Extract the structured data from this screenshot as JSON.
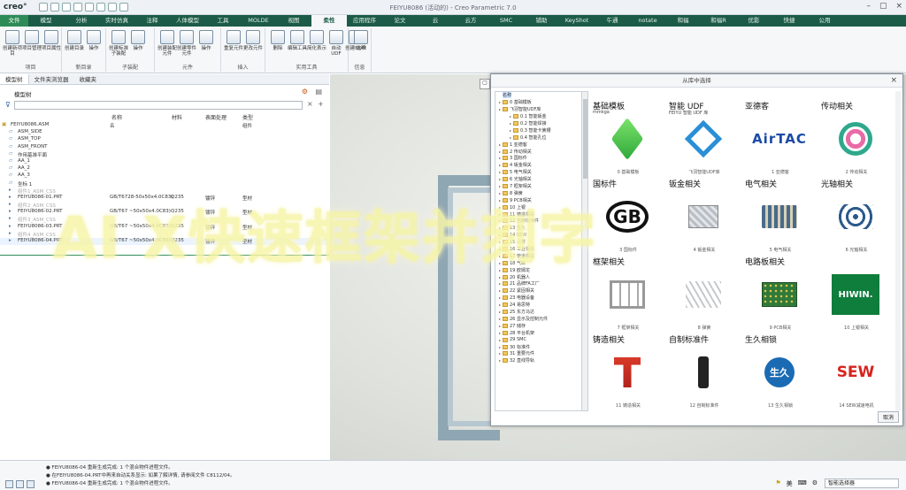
{
  "app": {
    "logo": "creo°",
    "window_title": "FEIYU8086 (活动的) - Creo Parametric 7.0"
  },
  "ribbon": {
    "tabs": [
      "文件",
      "模型",
      "分析",
      "实时仿真",
      "注释",
      "人体模型",
      "工具",
      "MOLDE",
      "视图",
      "柔性",
      "应用程序",
      "论文",
      "云",
      "云方",
      "SMC",
      "铺助",
      "KeyShot",
      "午通",
      "notate",
      "和福",
      "和福R",
      "优影",
      "快捷",
      "公用"
    ],
    "groups": [
      {
        "name": "项目",
        "buttons": [
          "创建新项目",
          "项目管理",
          "项目属性"
        ]
      },
      {
        "name": "新目录",
        "buttons": [
          "创建目录",
          "操作"
        ]
      },
      {
        "name": "子装配",
        "buttons": [
          "创建标准子装配",
          "操作"
        ]
      },
      {
        "name": "元件",
        "buttons": [
          "创建装配元件",
          "创建零件元件",
          "操作"
        ]
      },
      {
        "name": "插入",
        "buttons": [
          "重复元件",
          "更改元件"
        ]
      },
      {
        "name": "实用工具",
        "buttons": [
          "删除",
          "编辑工具",
          "简化表示",
          "自动 UDF",
          "创建BOM"
        ]
      },
      {
        "name": "信息",
        "buttons": [
          "选项"
        ]
      }
    ]
  },
  "model_panel": {
    "tabs": [
      "模型树",
      "文件夹浏览器",
      "收藏夹"
    ],
    "tree_label": "模型树",
    "columns": [
      "名称",
      "材料",
      "表面处理",
      "类型"
    ],
    "rows": [
      {
        "name": "FEIYU8086.ASM",
        "c1": "名",
        "c2": "",
        "c3": "",
        "c4": "组件",
        "style": "normal"
      },
      {
        "name": "ASM_SIDE",
        "c1": "",
        "c2": "",
        "c3": "",
        "c4": "",
        "style": "normal"
      },
      {
        "name": "ASM_TOP",
        "c1": "",
        "c2": "",
        "c3": "",
        "c4": "",
        "style": "normal"
      },
      {
        "name": "ASM_FRONT",
        "c1": "",
        "c2": "",
        "c3": "",
        "c4": "",
        "style": "normal"
      },
      {
        "name": "作用基准平面",
        "c1": "",
        "c2": "",
        "c3": "",
        "c4": "",
        "style": "normal"
      },
      {
        "name": "AA_1",
        "c1": "",
        "c2": "",
        "c3": "",
        "c4": "",
        "style": "normal"
      },
      {
        "name": "AA_2",
        "c1": "",
        "c2": "",
        "c3": "",
        "c4": "",
        "style": "normal"
      },
      {
        "name": "AA_3",
        "c1": "",
        "c2": "",
        "c3": "",
        "c4": "",
        "style": "normal"
      },
      {
        "name": "坐标 1",
        "c1": "",
        "c2": "",
        "c3": "",
        "c4": "",
        "style": "normal"
      },
      {
        "name": "组件1_ASM_CSS",
        "c1": "",
        "c2": "",
        "c3": "",
        "c4": "",
        "style": "gray"
      },
      {
        "name": "FEIYU8086-01.PRT",
        "c1": "GB/T6728-50x50x4.0C83)",
        "c2": "Q235",
        "c3": "镀锌",
        "c4": "型材",
        "style": "normal"
      },
      {
        "name": "组件2_ASM_CSS",
        "c1": "",
        "c2": "",
        "c3": "",
        "c4": "",
        "style": "gray"
      },
      {
        "name": "FEIYU8086-02.PRT",
        "c1": "GB/T67 ~50x50x4.0C83)",
        "c2": "Q235",
        "c3": "镀锌",
        "c4": "型材",
        "style": "normal"
      },
      {
        "name": "组件3_ASM_CSS",
        "c1": "",
        "c2": "",
        "c3": "",
        "c4": "",
        "style": "gray"
      },
      {
        "name": "FEIYU8086-03.PRT",
        "c1": "GB/T67 ~50x50x4.0C83)",
        "c2": "Q235",
        "c3": "镀锌",
        "c4": "型材",
        "style": "normal"
      },
      {
        "name": "组件4_ASM_CSS",
        "c1": "",
        "c2": "",
        "c3": "",
        "c4": "",
        "style": "gray"
      },
      {
        "name": "FEIYU8086-04.PRT",
        "c1": "GB/T67 ~50x50x4.0C83)",
        "c2": "Q235",
        "c3": "镀锌",
        "c4": "型材",
        "style": "hl"
      }
    ]
  },
  "dialog": {
    "title": "从库中选择",
    "close": "×",
    "cancel_label": "取消",
    "tree": [
      {
        "label": "名称",
        "level": 0,
        "root": true
      },
      {
        "label": "0 基础模板",
        "level": 0
      },
      {
        "label": "飞羽智能UDF库",
        "level": 0
      },
      {
        "label": "0.1 智能钣金",
        "level": 1
      },
      {
        "label": "0.2 智能焊接",
        "level": 1
      },
      {
        "label": "0.3 智能卡簧槽",
        "level": 1
      },
      {
        "label": "0.4 智能孔位",
        "level": 1
      },
      {
        "label": "1 亚德客",
        "level": 0
      },
      {
        "label": "2 传动相关",
        "level": 0
      },
      {
        "label": "3 国标件",
        "level": 0
      },
      {
        "label": "4 钣金相关",
        "level": 0
      },
      {
        "label": "5 电气相关",
        "level": 0
      },
      {
        "label": "6 光轴相关",
        "level": 0
      },
      {
        "label": "7 框架相关",
        "level": 0
      },
      {
        "label": "8 弹簧",
        "level": 0
      },
      {
        "label": "9 PCB相关",
        "level": 0
      },
      {
        "label": "10 上银",
        "level": 0
      },
      {
        "label": "11 铸造相关",
        "level": 0
      },
      {
        "label": "12 自制标准件",
        "level": 0
      },
      {
        "label": "13 生久",
        "level": 0
      },
      {
        "label": "14 SEW",
        "level": 0
      },
      {
        "label": "15 三菱",
        "level": 0
      },
      {
        "label": "16 工业相关",
        "level": 0
      },
      {
        "label": "17 管道相关",
        "level": 0
      },
      {
        "label": "18 气缸",
        "level": 0
      },
      {
        "label": "19 欧姆龙",
        "level": 0
      },
      {
        "label": "20 机器人",
        "level": 0
      },
      {
        "label": "21 品牌FA工厂",
        "level": 0
      },
      {
        "label": "22 紧固相关",
        "level": 0
      },
      {
        "label": "23 电器设备",
        "level": 0
      },
      {
        "label": "24 易思特",
        "level": 0
      },
      {
        "label": "25 东方马达",
        "level": 0
      },
      {
        "label": "26 显示及控制元件",
        "level": 0
      },
      {
        "label": "27 储存",
        "level": 0
      },
      {
        "label": "28 平台机架",
        "level": 0
      },
      {
        "label": "29 SMC",
        "level": 0
      },
      {
        "label": "30 标准件",
        "level": 0
      },
      {
        "label": "31 重要元件",
        "level": 0
      },
      {
        "label": "32 直线导轨",
        "level": 0
      }
    ],
    "categories": [
      {
        "title": "基础模板",
        "sub": "mmkga",
        "caption": "0 基础模板",
        "icon": "cube-icon"
      },
      {
        "title": "智能 UDF",
        "sub": "FEIYU 智能 UDF 库",
        "caption": "飞羽智能UDF库",
        "icon": "udf-icon"
      },
      {
        "title": "亚德客",
        "sub": "",
        "caption": "1 亚德客",
        "icon": "airtac-logo"
      },
      {
        "title": "传动相关",
        "sub": "",
        "caption": "2 传动相关",
        "icon": "bearing-icon"
      },
      {
        "title": "国标件",
        "sub": "",
        "caption": "3 国标件",
        "icon": "gb-logo"
      },
      {
        "title": "钣金相关",
        "sub": "",
        "caption": "4 钣金相关",
        "icon": "sheetmetal-icon"
      },
      {
        "title": "电气相关",
        "sub": "",
        "caption": "5 电气相关",
        "icon": "electrical-icon"
      },
      {
        "title": "光轴相关",
        "sub": "",
        "caption": "6 光轴相关",
        "icon": "shaft-icon"
      },
      {
        "title": "框架相关",
        "sub": "",
        "caption": "7 框架相关",
        "icon": "frame-icon"
      },
      {
        "title": "",
        "sub": "",
        "caption": "8 弹簧",
        "icon": "spring-icon"
      },
      {
        "title": "电路板相关",
        "sub": "",
        "caption": "9 PCB相关",
        "icon": "pcb-icon"
      },
      {
        "title": "",
        "sub": "",
        "caption": "10 上银相关",
        "icon": "hiwin-logo"
      },
      {
        "title": "铸造相关",
        "sub": "",
        "caption": "11 铸造相关",
        "icon": "casting-icon"
      },
      {
        "title": "自制标准件",
        "sub": "",
        "caption": "12 自制标准件",
        "icon": "custom-part-icon"
      },
      {
        "title": "生久相锁",
        "sub": "",
        "caption": "13 生久相锁",
        "icon": "shengjiu-logo"
      },
      {
        "title": "",
        "sub": "",
        "caption": "14 SEW减速电机",
        "icon": "sew-logo"
      }
    ],
    "logos": {
      "airtac": "AirTAC",
      "hiwin": "HIWIN.",
      "sew": "SEW",
      "gb": "GB",
      "shengjiu": "生久"
    }
  },
  "overlay_text": "AI X快速框架并刻字",
  "messages": [
    "● FEIYU8086-04 重新生成完成: 1 个混合物件进程文件。",
    "● 在FEIYU8086-04.PRT中再来自动关系显示: 如果了解详情, 请参阅文件 C8112/04。",
    "● FEIYU8086-04 重新生成完成: 1 个混合物件进程文件。"
  ],
  "status": {
    "filter": "智能选择器",
    "lang": "美"
  },
  "colors": {
    "ribbon_green": "#1c5b47",
    "accent_green": "#2e8b57",
    "hiwin_green": "#0f7d3c",
    "sew_red": "#d6241f"
  }
}
